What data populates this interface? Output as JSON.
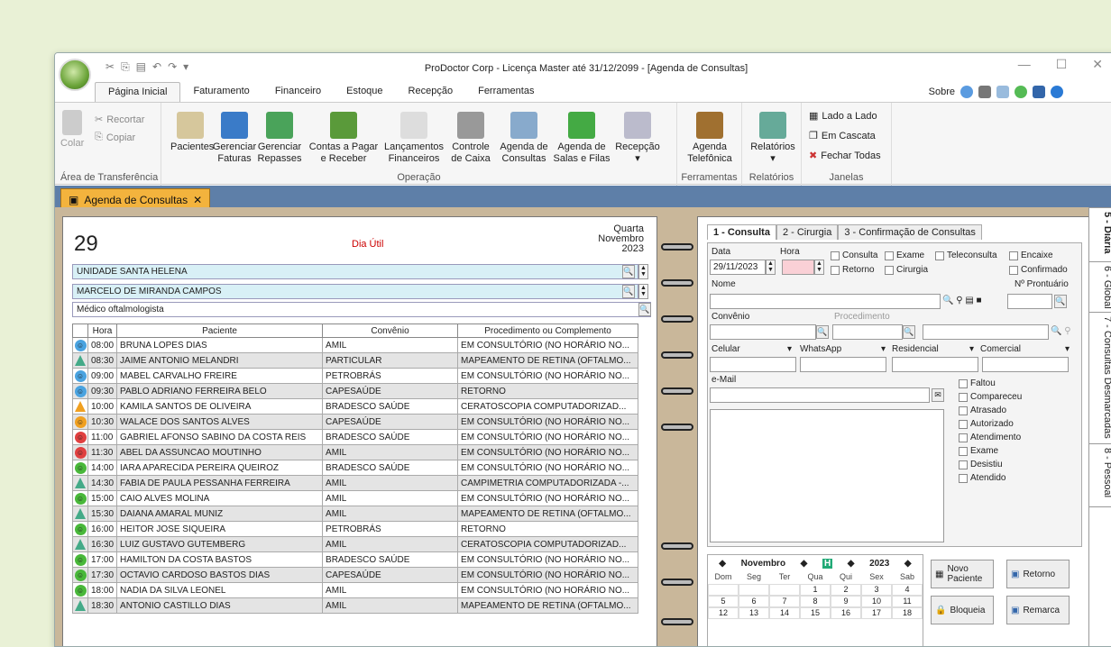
{
  "window": {
    "title": "ProDoctor Corp - Licença Master até 31/12/2099 - [Agenda de Consultas]"
  },
  "menu": {
    "tabs": [
      "Página Inicial",
      "Faturamento",
      "Financeiro",
      "Estoque",
      "Recepção",
      "Ferramentas"
    ],
    "sobre": "Sobre"
  },
  "ribbon": {
    "clipboard": {
      "colar": "Colar",
      "recortar": "Recortar",
      "copiar": "Copiar",
      "group": "Área de Transferência"
    },
    "operacao": {
      "pacientes": "Pacientes",
      "faturas": "Gerenciar\nFaturas",
      "repasses": "Gerenciar\nRepasses",
      "contas": "Contas a Pagar\ne Receber",
      "lanc": "Lançamentos\nFinanceiros",
      "caixa": "Controle\nde Caixa",
      "agenda": "Agenda de\nConsultas",
      "salas": "Agenda de\nSalas e Filas",
      "recepcao": "Recepção",
      "group": "Operação"
    },
    "ferramentas": {
      "tel": "Agenda\nTelefônica",
      "group": "Ferramentas"
    },
    "relatorios": {
      "rel": "Relatórios",
      "group": "Relatórios"
    },
    "janelas": {
      "lado": "Lado a Lado",
      "cascata": "Em Cascata",
      "fechar": "Fechar Todas",
      "group": "Janelas"
    }
  },
  "doc_tab": "Agenda de Consultas",
  "agenda": {
    "day": "29",
    "status": "Dia Útil",
    "weekday": "Quarta",
    "month": "Novembro",
    "year": "2023",
    "unidade": "UNIDADE SANTA HELENA",
    "medico": "MARCELO DE MIRANDA CAMPOS",
    "especialidade": "Médico oftalmologista",
    "columns": [
      "Hora",
      "Paciente",
      "Convênio",
      "Procedimento ou Complemento"
    ],
    "rows": [
      {
        "h": "08:00",
        "p": "BRUNA LOPES DIAS",
        "c": "AMIL",
        "pr": "EM CONSULTÓRIO (NO HORÁRIO NO...",
        "s": "blue"
      },
      {
        "h": "08:30",
        "p": "JAIME ANTONIO MELANDRI",
        "c": "PARTICULAR",
        "pr": "MAPEAMENTO DE RETINA (OFTALMO...",
        "s": "flask"
      },
      {
        "h": "09:00",
        "p": "MABEL CARVALHO FREIRE",
        "c": "PETROBRÁS",
        "pr": "EM CONSULTÓRIO (NO HORÁRIO NO...",
        "s": "blue"
      },
      {
        "h": "09:30",
        "p": "PABLO ADRIANO FERREIRA BELO",
        "c": "CAPESAÚDE",
        "pr": "RETORNO",
        "s": "blueR"
      },
      {
        "h": "10:00",
        "p": "KAMILA SANTOS DE OLIVEIRA",
        "c": "BRADESCO SAÚDE",
        "pr": "CERATOSCOPIA COMPUTADORIZAD...",
        "s": "flaskO"
      },
      {
        "h": "10:30",
        "p": "WALACE DOS SANTOS ALVES",
        "c": "CAPESAÚDE",
        "pr": "EM CONSULTÓRIO (NO HORÁRIO NO...",
        "s": "orange"
      },
      {
        "h": "11:00",
        "p": "GABRIEL AFONSO SABINO DA COSTA REIS",
        "c": "BRADESCO SAÚDE",
        "pr": "EM CONSULTÓRIO (NO HORÁRIO NO...",
        "s": "red"
      },
      {
        "h": "11:30",
        "p": "ABEL DA ASSUNCAO MOUTINHO",
        "c": "AMIL",
        "pr": "EM CONSULTÓRIO (NO HORÁRIO NO...",
        "s": "red"
      },
      {
        "h": "14:00",
        "p": "IARA APARECIDA PEREIRA QUEIROZ",
        "c": "BRADESCO SAÚDE",
        "pr": "EM CONSULTÓRIO (NO HORÁRIO NO...",
        "s": "green"
      },
      {
        "h": "14:30",
        "p": "FABIA DE PAULA PESSANHA FERREIRA",
        "c": "AMIL",
        "pr": "CAMPIMETRIA COMPUTADORIZADA -...",
        "s": "flask"
      },
      {
        "h": "15:00",
        "p": "CAIO ALVES MOLINA",
        "c": "AMIL",
        "pr": "EM CONSULTÓRIO (NO HORÁRIO NO...",
        "s": "green"
      },
      {
        "h": "15:30",
        "p": "DAIANA AMARAL MUNIZ",
        "c": "AMIL",
        "pr": "MAPEAMENTO DE RETINA (OFTALMO...",
        "s": "flask"
      },
      {
        "h": "16:00",
        "p": "HEITOR JOSE SIQUEIRA",
        "c": "PETROBRÁS",
        "pr": "RETORNO",
        "s": "greenR"
      },
      {
        "h": "16:30",
        "p": "LUIZ GUSTAVO GUTEMBERG",
        "c": "AMIL",
        "pr": "CERATOSCOPIA COMPUTADORIZAD...",
        "s": "flask"
      },
      {
        "h": "17:00",
        "p": "HAMILTON DA COSTA BASTOS",
        "c": "BRADESCO SAÚDE",
        "pr": "EM CONSULTÓRIO (NO HORÁRIO NO...",
        "s": "green"
      },
      {
        "h": "17:30",
        "p": "OCTAVIO CARDOSO BASTOS DIAS",
        "c": "CAPESAÚDE",
        "pr": "EM CONSULTÓRIO (NO HORÁRIO NO...",
        "s": "green"
      },
      {
        "h": "18:00",
        "p": "NADIA DA SILVA LEONEL",
        "c": "AMIL",
        "pr": "EM CONSULTÓRIO (NO HORÁRIO NO...",
        "s": "green"
      },
      {
        "h": "18:30",
        "p": "ANTONIO CASTILLO DIAS",
        "c": "AMIL",
        "pr": "MAPEAMENTO DE RETINA (OFTALMO...",
        "s": "flask"
      }
    ]
  },
  "consulta": {
    "tabs": [
      "1 - Consulta",
      "2 - Cirurgia",
      "3 - Confirmação de Consultas"
    ],
    "data_label": "Data",
    "data": "29/11/2023",
    "hora_label": "Hora",
    "checks_top": [
      "Consulta",
      "Exame",
      "Teleconsulta",
      "Encaixe"
    ],
    "checks_2": [
      "Retorno",
      "Cirurgia"
    ],
    "confirmado": "Confirmado",
    "prontuario": "Nº Prontuário",
    "nome": "Nome",
    "convenio": "Convênio",
    "procedimento": "Procedimento",
    "celular": "Celular",
    "whatsapp": "WhatsApp",
    "residencial": "Residencial",
    "comercial": "Comercial",
    "email": "e-Mail",
    "status_checks": [
      "Faltou",
      "Compareceu",
      "Atrasado",
      "Autorizado",
      "Atendimento",
      "Exame",
      "Desistiu",
      "Atendido"
    ]
  },
  "calendar": {
    "month": "Novembro",
    "year": "2023",
    "days": [
      "Dom",
      "Seg",
      "Ter",
      "Qua",
      "Qui",
      "Sex",
      "Sab"
    ],
    "week1": [
      "",
      "",
      "",
      "1",
      "2",
      "3",
      "4"
    ],
    "week2": [
      "5",
      "6",
      "7",
      "8",
      "9",
      "10",
      "11"
    ],
    "week3": [
      "12",
      "13",
      "14",
      "15",
      "16",
      "17",
      "18"
    ]
  },
  "buttons": {
    "novo": "Novo\nPaciente",
    "retorno": "Retorno",
    "bloqueia": "Bloqueia",
    "remarca": "Remarca"
  },
  "side_tabs": [
    "5 - Diária",
    "6 - Global",
    "7 - Consultas Desmarcadas",
    "8 - Pessoal"
  ]
}
